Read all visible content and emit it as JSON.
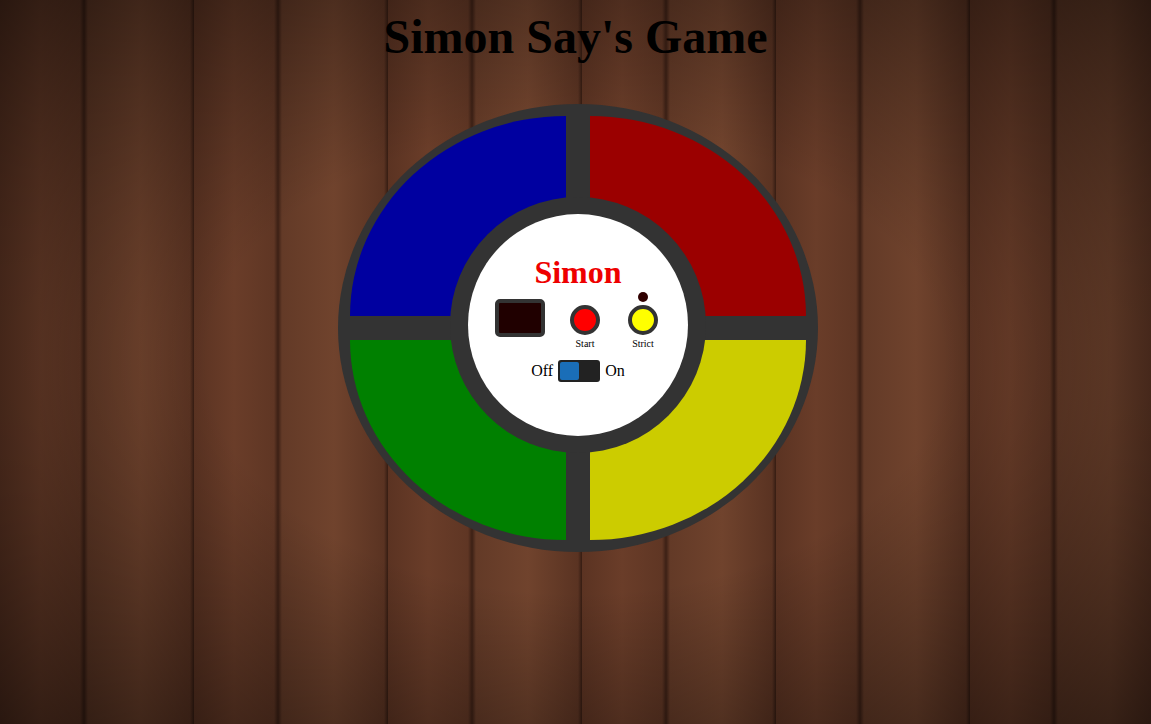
{
  "page": {
    "title": "Simon Say's Game"
  },
  "device": {
    "name": "Simon",
    "pads": [
      {
        "position": "top-left",
        "color": "#0000a0"
      },
      {
        "position": "top-right",
        "color": "#9b0000"
      },
      {
        "position": "bottom-left",
        "color": "#008000"
      },
      {
        "position": "bottom-right",
        "color": "#cccc00"
      }
    ],
    "display": {
      "lit": false
    },
    "buttons": [
      {
        "label": "Start",
        "kind": "button",
        "color": "#ff0000",
        "led_on": false
      },
      {
        "label": "Strict",
        "kind": "led-button",
        "color": "#ffff00",
        "led_on": false
      }
    ],
    "power": {
      "off_label": "Off",
      "on_label": "On",
      "on": false
    }
  }
}
